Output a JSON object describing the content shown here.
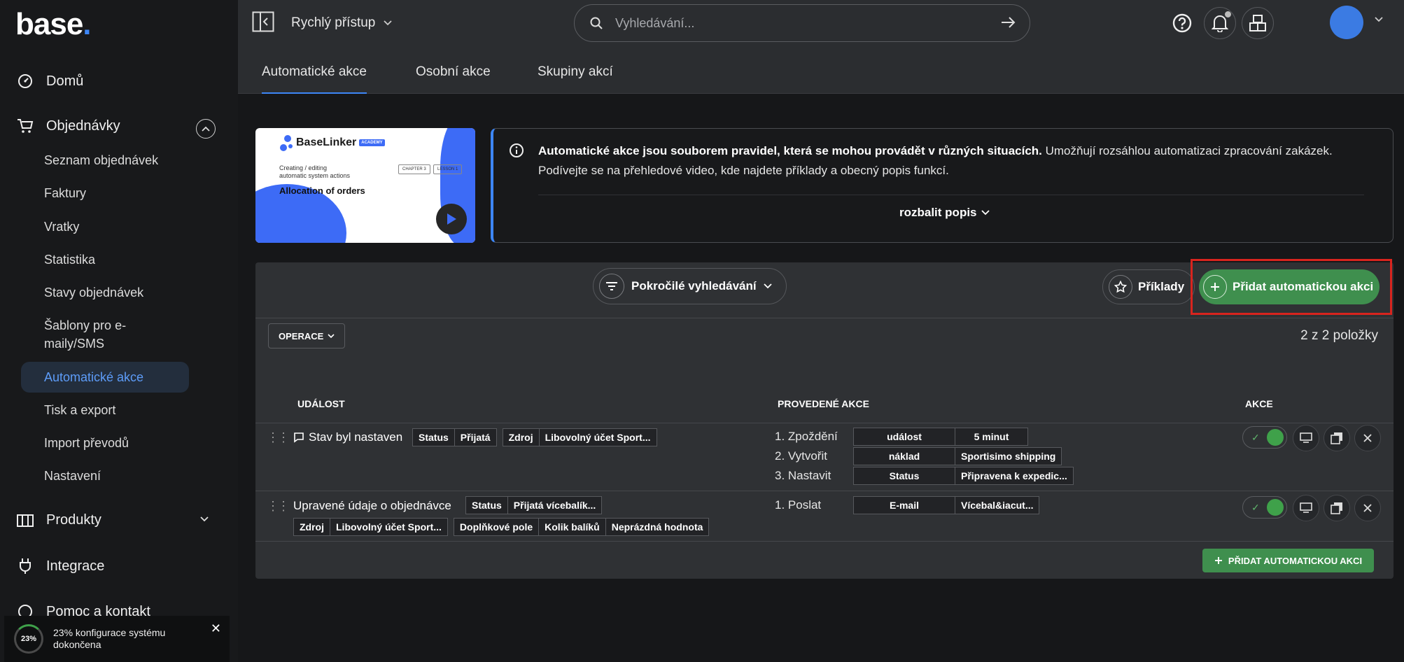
{
  "brand": {
    "name": "base",
    "dot": "."
  },
  "sidebar": {
    "items": [
      {
        "label": "Domů"
      },
      {
        "label": "Objednávky"
      },
      {
        "label": "Produkty"
      },
      {
        "label": "Integrace"
      },
      {
        "label": "Pomoc a kontakt"
      }
    ],
    "sub": [
      "Seznam objednávek",
      "Faktury",
      "Vratky",
      "Statistika",
      "Stavy objednávek",
      "Šablony pro e-\nmaily/SMS",
      "Automatické akce",
      "Tisk a export",
      "Import převodů",
      "Nastavení"
    ],
    "active_sub": "Automatické akce"
  },
  "toast": {
    "percent": "23%",
    "text": "23% konfigurace systému dokončena",
    "close": "✕"
  },
  "topbar": {
    "quick_access": "Rychlý přístup",
    "search_placeholder": "Vyhledávání..."
  },
  "tabs": [
    "Automatické akce",
    "Osobní akce",
    "Skupiny akcí"
  ],
  "video": {
    "brand": "BaseLinker",
    "badge": "ACADEMY",
    "subtitle": "Creating / editing\nautomatic system actions",
    "title": "Allocation of orders",
    "chip1": "CHAPTER 3",
    "chip2": "LESSON 1"
  },
  "info": {
    "bold": "Automatické akce jsou souborem pravidel, která se mohou provádět v různých situacích.",
    "rest": " Umožňují rozsáhlou automatizaci zpracování zakázek. Podívejte se na přehledové video, kde najdete příklady a obecný popis funkcí.",
    "expand": "rozbalit popis"
  },
  "toolbar": {
    "advanced_search": "Pokročilé vyhledávání",
    "examples": "Příklady",
    "add_action": "Přidat automatickou akci",
    "operations": "OPERACE",
    "count": "2 z 2 položky"
  },
  "table": {
    "headers": [
      "UDÁLOST",
      "PROVEDENÉ AKCE",
      "AKCE"
    ],
    "rows": [
      {
        "event": "Stav byl nastaven",
        "conditions": [
          [
            "Status",
            "Přijatá"
          ],
          [
            "Zdroj",
            "Libovolný účet Sport..."
          ]
        ],
        "actions": [
          {
            "label": "1. Zpoždění",
            "key": "událost",
            "value": "5 minut"
          },
          {
            "label": "2. Vytvořit",
            "key": "náklad",
            "value": "Sportisimo shipping"
          },
          {
            "label": "3. Nastavit",
            "key": "Status",
            "value": "Připravena k expedic..."
          }
        ]
      },
      {
        "event": "Upravené údaje o objednávce",
        "conditions": [
          [
            "Status",
            "Přijatá vícebalík..."
          ],
          [
            "Zdroj",
            "Libovolný účet Sport..."
          ],
          [
            "Doplňkové pole",
            "Kolik balíků",
            "Neprázdná hodnota"
          ]
        ],
        "actions": [
          {
            "label": "1. Poslat",
            "key": "E-mail",
            "value": "Vícebal&iacut..."
          }
        ]
      }
    ],
    "add_bottom": "PŘIDAT AUTOMATICKOU AKCI"
  },
  "colors": {
    "accent": "#3d86f6",
    "green": "#3f8f4e",
    "highlight": "#d8241e"
  }
}
